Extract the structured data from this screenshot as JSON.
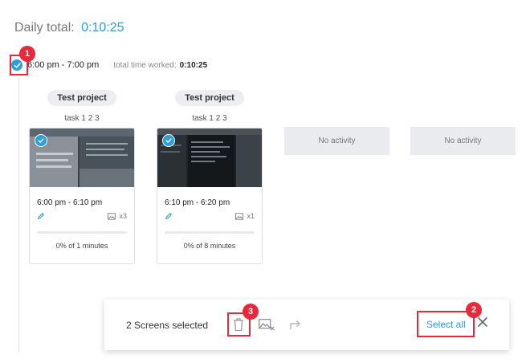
{
  "header": {
    "daily_total_label": "Daily total:",
    "daily_total_value": "0:10:25"
  },
  "time_row": {
    "range": "6:00 pm - 7:00 pm",
    "total_label": "total time worked:",
    "total_value": "0:10:25"
  },
  "cards": [
    {
      "project": "Test project",
      "task": "task 1 2 3",
      "time": "6:00 pm - 6:10 pm",
      "shots": "x3",
      "progress_text": "0% of 1 minutes",
      "progress": 0
    },
    {
      "project": "Test project",
      "task": "task 1 2 3",
      "time": "6:10 pm - 6:20 pm",
      "shots": "x1",
      "progress_text": "0% of 8 minutes",
      "progress": 0
    }
  ],
  "empty_slots": [
    {
      "label": "No activity"
    },
    {
      "label": "No activity"
    }
  ],
  "action_bar": {
    "selected_text": "2 Screens selected",
    "select_all": "Select all",
    "icons": [
      "trash-icon",
      "image-remove-icon",
      "move-arrow-icon",
      "close-icon"
    ]
  },
  "callouts": [
    "1",
    "2",
    "3"
  ],
  "colors": {
    "accent": "#2c9ed8",
    "callout": "#e8283b",
    "pill_bg": "#eceef1",
    "empty_bg": "#e9ebee"
  }
}
